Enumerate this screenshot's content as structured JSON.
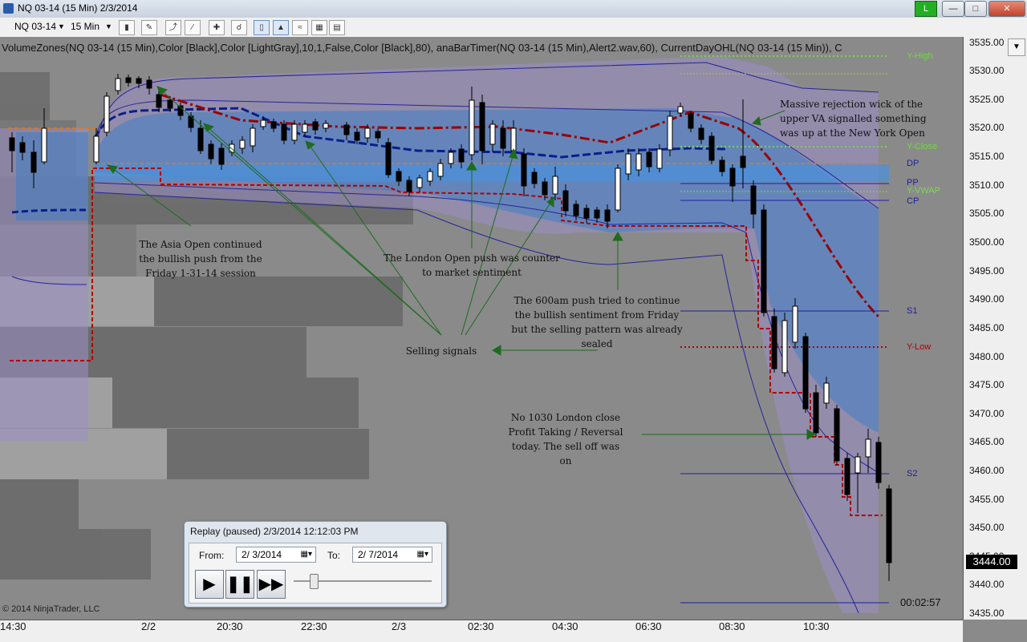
{
  "window": {
    "title": "NQ 03-14 (15 Min)  2/3/2014",
    "connection_label": "L",
    "ghost_tab": "NQ"
  },
  "toolbar": {
    "instrument": "NQ 03-14",
    "interval": "15 Min"
  },
  "indicators_text": "VolumeZones(NQ  03-14  (15  Min),Color  [Black],Color  [LightGray],10,1,False,Color  [Black],80),  anaBarTimer(NQ  03-14  (15  Min),Alert2.wav,60),  CurrentDayOHL(NQ  03-14  (15  Min)),  C",
  "annotations": {
    "asia": "The Asia Open continued\nthe bullish push from the\nFriday 1-31-14 session",
    "london": "The London Open push was counter\nto market sentiment",
    "push600": "The 600am push tried to continue\nthe bullish sentiment from Friday\nbut the selling pattern was already\nsealed",
    "selling": "Selling signals",
    "rejection": "Massive rejection wick of the\nupper VA signalled something\nwas up at the New York Open",
    "close1030": "No 1030 London close\nProfit Taking / Reversal\ntoday. The sell off was on"
  },
  "levels": {
    "y_high": "Y-High",
    "y_close": "Y-Close",
    "dp": "DP",
    "pp": "PP",
    "y_vwap": "Y-VWAP",
    "cp": "CP",
    "s1": "S1",
    "y_low": "Y-Low",
    "s2": "S2"
  },
  "price_axis": [
    "3535.00",
    "3530.00",
    "3525.00",
    "3520.00",
    "3515.00",
    "3510.00",
    "3505.00",
    "3500.00",
    "3495.00",
    "3490.00",
    "3485.00",
    "3480.00",
    "3475.00",
    "3470.00",
    "3465.00",
    "3460.00",
    "3455.00",
    "3450.00",
    "3445.00",
    "3440.00",
    "3435.00"
  ],
  "time_axis": [
    "14:30",
    "2/2",
    "20:30",
    "22:30",
    "2/3",
    "02:30",
    "04:30",
    "06:30",
    "08:30",
    "10:30"
  ],
  "current_price": "3444.00",
  "bar_timer": "00:02:57",
  "copyright": "© 2014 NinjaTrader, LLC",
  "replay": {
    "title": "Replay (paused) 2/3/2014 12:12:03 PM",
    "from_label": "From:",
    "from_date": "2/  3/2014",
    "to_label": "To:",
    "to_date": "2/  7/2014"
  },
  "colors": {
    "background": "#8a8a8a",
    "value_area": "#3f7fc6",
    "envelope": "#9a8ec4",
    "vwap_red": "#9b0000",
    "y_high_green": "#6ddc3a",
    "y_low_red": "#b00000",
    "level_blue": "#1f1f9e"
  }
}
